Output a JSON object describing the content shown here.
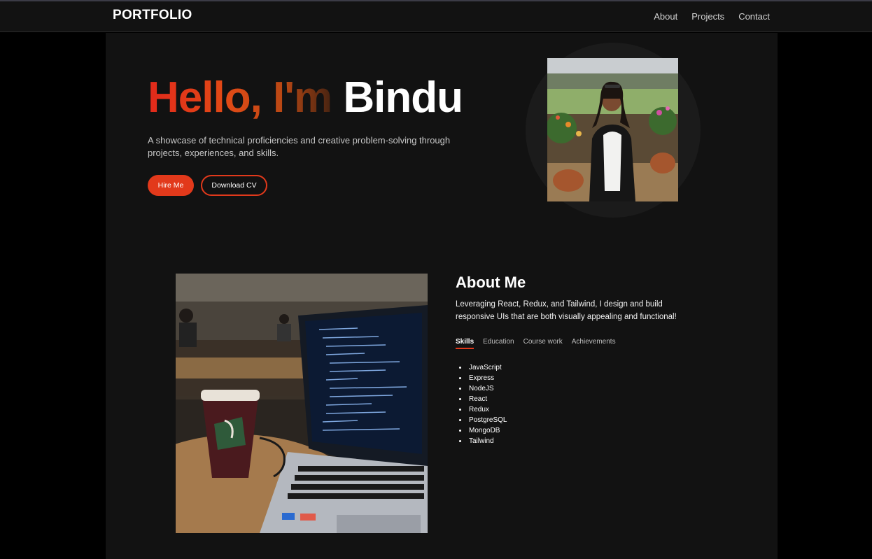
{
  "brand": "PORTFOLIO",
  "nav": {
    "items": [
      "About",
      "Projects",
      "Contact"
    ]
  },
  "hero": {
    "greeting": "Hello, I'm ",
    "name": "Bindu",
    "subtitle": "A showcase of technical proficiencies and creative problem-solving through projects, experiences, and skills.",
    "hire_label": "Hire Me",
    "cv_label": "Download CV"
  },
  "about": {
    "title": "About Me",
    "text": "Leveraging React, Redux, and Tailwind, I design and build responsive UIs that are both visually appealing and functional!",
    "tabs": [
      "Skills",
      "Education",
      "Course work",
      "Achievements"
    ],
    "active_tab": "Skills",
    "skills": [
      "JavaScript",
      "Express",
      "NodeJS",
      "React",
      "Redux",
      "PostgreSQL",
      "MongoDB",
      "Tailwind"
    ]
  },
  "colors": {
    "accent": "#e2391b",
    "page_bg": "#000000",
    "panel_bg": "#121212",
    "nav_bg": "#121212"
  }
}
